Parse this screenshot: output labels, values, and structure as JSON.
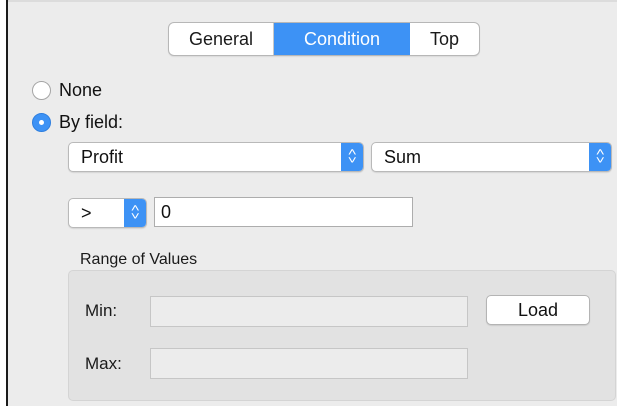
{
  "tabs": [
    {
      "label": "General"
    },
    {
      "label": "Condition",
      "selected": true
    },
    {
      "label": "Top"
    }
  ],
  "condition": {
    "radio_none": {
      "label": "None",
      "selected": false
    },
    "radio_by_field": {
      "label": "By field:",
      "selected": true
    },
    "field_select": {
      "value": "Profit"
    },
    "aggregation_select": {
      "value": "Sum"
    },
    "operator_select": {
      "value": ">"
    },
    "value_input": {
      "value": "0"
    }
  },
  "range": {
    "title": "Range of Values",
    "min_label": "Min:",
    "min_value": "",
    "max_label": "Max:",
    "max_value": "",
    "load_label": "Load"
  },
  "colors": {
    "accent": "#3d92f5",
    "background": "#ececec",
    "group_background": "#e2e2e2"
  }
}
